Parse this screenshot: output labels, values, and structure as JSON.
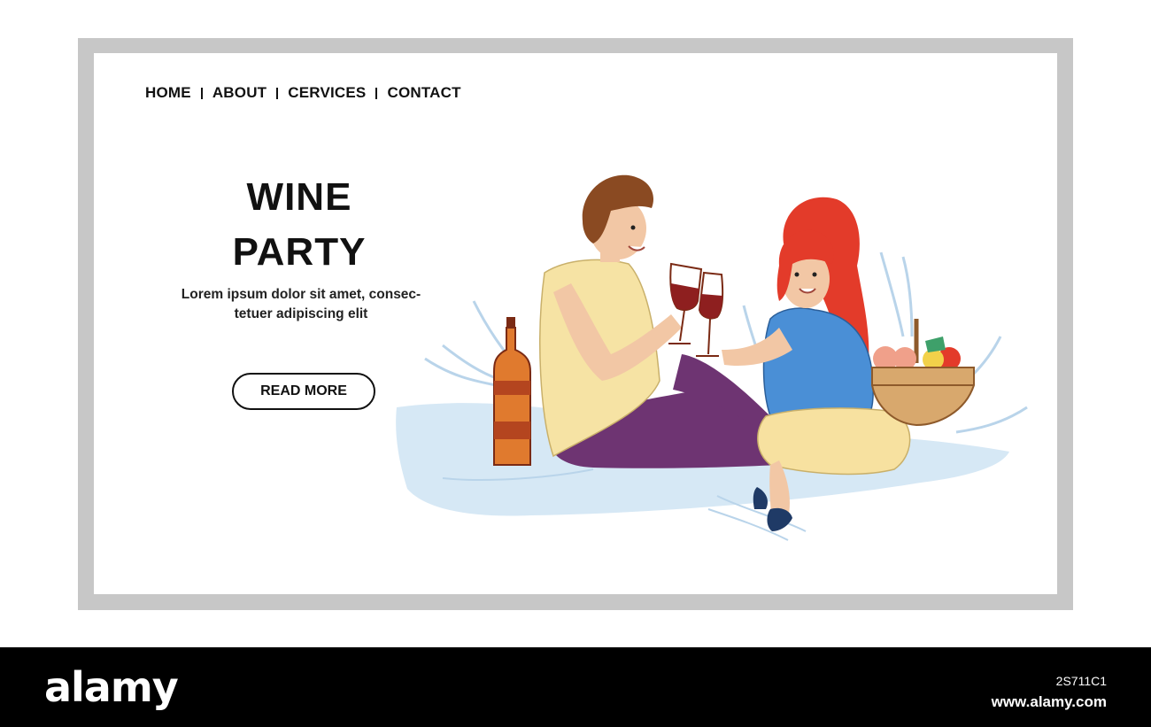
{
  "nav": {
    "items": [
      "HOME",
      "ABOUT",
      "CERVICES",
      "CONTACT"
    ]
  },
  "hero": {
    "title_line1": "WINE",
    "title_line2": "PARTY",
    "subtitle_line1": "Lorem ipsum dolor sit amet, consec-",
    "subtitle_line2": "tetuer adipiscing elit",
    "button_label": "READ MORE"
  },
  "footer": {
    "logo": "alamy",
    "image_id": "2S711C1",
    "site": "www.alamy.com"
  },
  "colors": {
    "frame": "#c7c7c7",
    "blanket": "#d6e8f5",
    "bottle": "#e07a2e",
    "wine": "#8e1f1f",
    "man_shirt": "#f6e3a4",
    "man_pants": "#6e3472",
    "woman_hair": "#e33b2a",
    "woman_shirt": "#4a8fd6",
    "woman_skirt": "#f7e1a0",
    "basket": "#d8a86d",
    "footer_bg": "#000000"
  },
  "icons": [
    "wine-bottle-icon",
    "wine-glass-icon",
    "picnic-basket-icon"
  ]
}
